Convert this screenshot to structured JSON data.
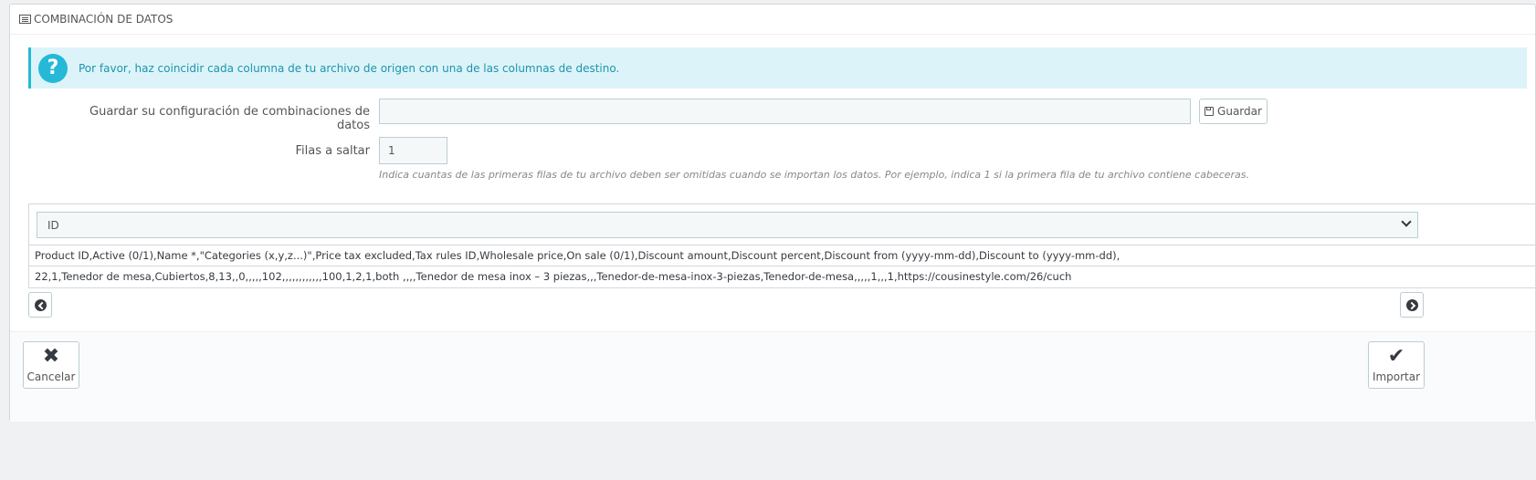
{
  "panel": {
    "title": "COMBINACIÓN DE DATOS",
    "title_icon": "list-icon"
  },
  "alert": {
    "icon": "question-icon",
    "text": "Por favor, haz coincidir cada columna de tu archivo de origen con una de las columnas de destino."
  },
  "save_config": {
    "label": "Guardar su configuración de combinaciones de datos",
    "value": "",
    "button_label": "Guardar",
    "button_icon": "floppy-icon"
  },
  "skip_rows": {
    "label": "Filas a saltar",
    "value": "1",
    "help": "Indica cuantas de las primeras filas de tu archivo deben ser omitidas cuando se importan los datos. Por ejemplo, indica 1 si la primera fila de tu archivo contiene cabeceras."
  },
  "mapping": {
    "selected_column": "ID",
    "rows": [
      "Product ID,Active (0/1),Name *,\"Categories (x,y,z...)\",Price tax excluded,Tax rules ID,Wholesale price,On sale (0/1),Discount amount,Discount percent,Discount from (yyyy-mm-dd),Discount to (yyyy-mm-dd),",
      "22,1,Tenedor de mesa,Cubiertos,8,13,,0,,,,,102,,,,,,,,,,,,100,1,2,1,both ,,,,Tenedor de mesa inox – 3 piezas,,,Tenedor-de-mesa-inox-3-piezas,Tenedor-de-mesa,,,,,1,,,1,https://cousinestyle.com/26/cuch"
    ],
    "prev_icon": "chevron-left-circle-icon",
    "next_icon": "chevron-right-circle-icon"
  },
  "footer": {
    "cancel_label": "Cancelar",
    "cancel_icon": "close-icon",
    "import_label": "Importar",
    "import_icon": "check-icon"
  },
  "colors": {
    "alert_bg": "#dcf4f9",
    "alert_accent": "#25b9d7",
    "page_bg": "#eff1f2"
  }
}
